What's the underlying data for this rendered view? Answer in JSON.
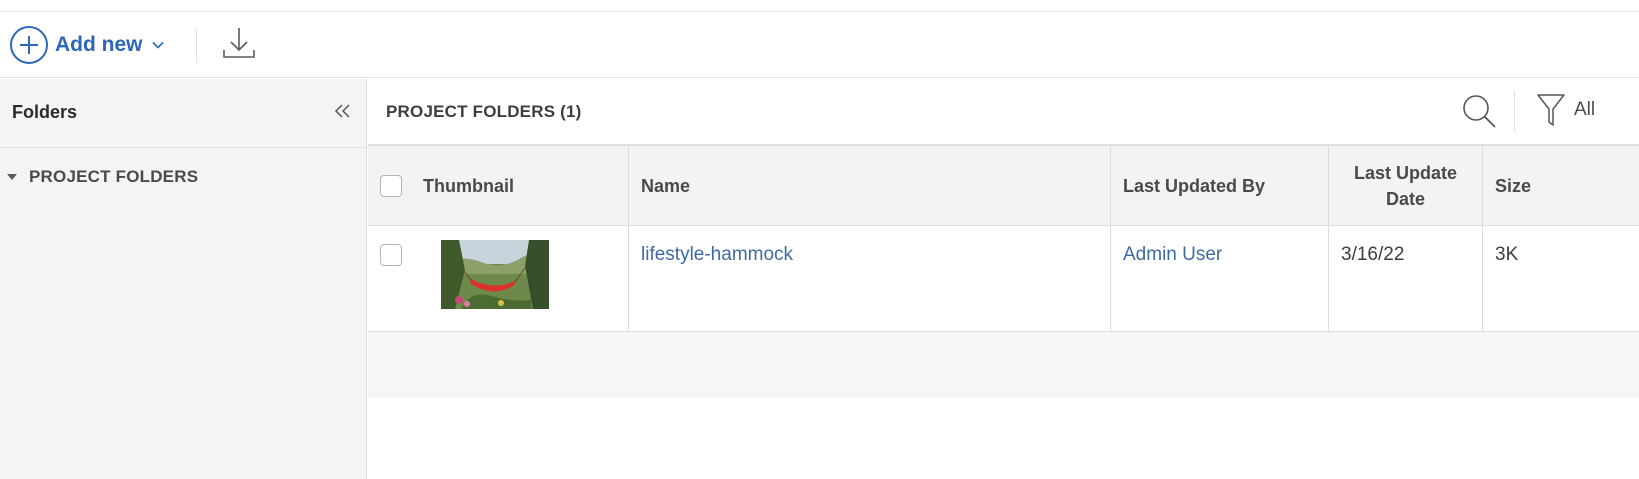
{
  "toolbar": {
    "add_new_label": "Add new",
    "plus_icon": "plus-circle-icon",
    "caret_icon": "chevron-down-icon",
    "download_icon": "download-icon",
    "accent_color": "#2c67ba"
  },
  "sidebar": {
    "title": "Folders",
    "collapse_icon": "double-chevron-left-icon",
    "tree": [
      {
        "label": "PROJECT FOLDERS",
        "expanded": true
      }
    ]
  },
  "main": {
    "title": "PROJECT FOLDERS (1)",
    "search_icon": "search-icon",
    "filter_icon": "filter-icon",
    "filter_label": "All"
  },
  "table": {
    "columns": {
      "thumbnail": "Thumbnail",
      "name": "Name",
      "last_updated_by": "Last Updated By",
      "last_update_date_line1": "Last Update",
      "last_update_date_line2": "Date",
      "size": "Size"
    },
    "rows": [
      {
        "name": "lifestyle-hammock",
        "last_updated_by": "Admin User",
        "last_update_date": "3/16/22",
        "size": "3K",
        "thumbnail_subject": "red hammock among trees"
      }
    ],
    "link_color": "#3f6aa3"
  }
}
